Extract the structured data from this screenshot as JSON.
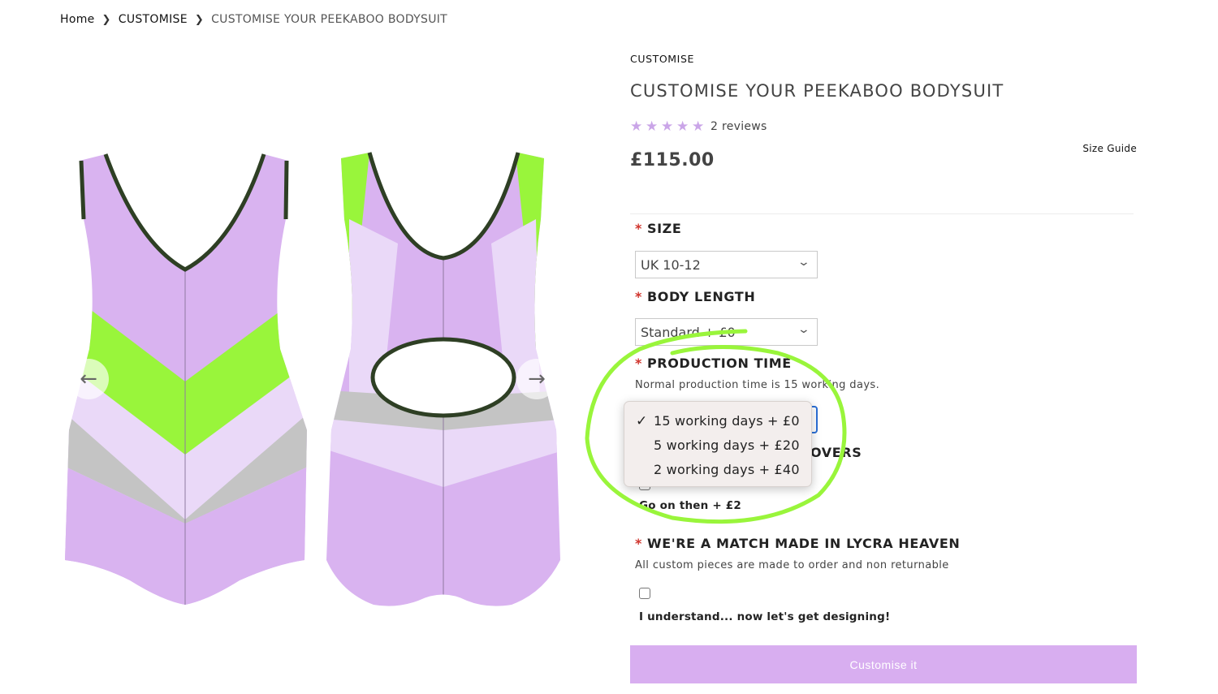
{
  "breadcrumb": {
    "home": "Home",
    "category": "CUSTOMISE",
    "current": "CUSTOMISE YOUR PEEKABOO BODYSUIT"
  },
  "gallery": {
    "prev_icon": "arrow-left-icon",
    "next_icon": "arrow-right-icon",
    "colors": {
      "body": "#d9b3f0",
      "lime": "#99f53b",
      "pale": "#ead9f8",
      "grey": "#c4c4c4",
      "trim": "#2e3f24"
    }
  },
  "product": {
    "vendor": "CUSTOMISE",
    "title": "CUSTOMISE YOUR PEEKABOO BODYSUIT",
    "rating": 5,
    "reviews": "2 reviews",
    "size_guide": "Size Guide",
    "price": "£115.00"
  },
  "options": {
    "size": {
      "label": "SIZE",
      "value": "UK 10-12"
    },
    "body_length": {
      "label": "BODY LENGTH",
      "value": "Standard + £0"
    },
    "production_time": {
      "label": "PRODUCTION TIME",
      "help": "Normal production time is 15 working days.",
      "options": [
        "15 working days + £0",
        "5 working days + £20",
        "2 working days + £40"
      ],
      "selected": "15 working days + £0"
    },
    "hidden_option": {
      "label_tail": "OVERS",
      "checkbox_label": "Go on then + £2"
    },
    "agreement": {
      "label": "WE'RE A MATCH MADE IN LYCRA HEAVEN",
      "help": "All custom pieces are made to order and non returnable",
      "checkbox_label": "I understand... now let's get designing!"
    }
  },
  "cta": {
    "label": "Customise it"
  },
  "colors": {
    "accent": "#d8aef0",
    "star": "#caa5e8",
    "required": "#d0342c",
    "annotation": "#99f53b",
    "focus": "#2a6fd6"
  },
  "required_marker": "*",
  "chevron_icon": "chevron-down-icon",
  "star_icon": "star-icon",
  "check_icon": "checkmark-icon"
}
